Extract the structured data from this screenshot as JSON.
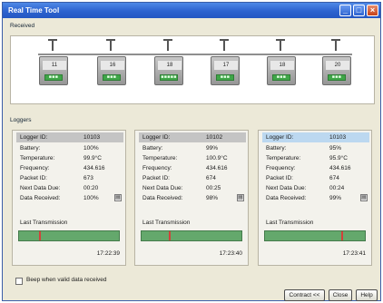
{
  "window": {
    "title": "Real Time Tool"
  },
  "received": {
    "label": "Received",
    "nodes": [
      {
        "id": "11",
        "led": "■■■"
      },
      {
        "id": "16",
        "led": "■■■"
      },
      {
        "id": "18",
        "led": "■■■■■"
      },
      {
        "id": "17",
        "led": "■■■"
      },
      {
        "id": "18",
        "led": "■■■"
      },
      {
        "id": "20",
        "led": "■■■"
      }
    ]
  },
  "loggers": {
    "label": "Loggers",
    "panels": [
      {
        "logger_id_label": "Logger ID:",
        "logger_id": "10103",
        "battery_label": "Battery:",
        "battery": "100%",
        "temperature_label": "Temperature:",
        "temperature": "99.9°C",
        "frequency_label": "Frequency:",
        "frequency": "434.616",
        "packet_id_label": "Packet ID:",
        "packet_id": "673",
        "next_data_due_label": "Next Data Due:",
        "next_data_due": "00:20",
        "data_received_label": "Data Received:",
        "data_received": "100%",
        "last_transmission_label": "Last Transmission",
        "last_transmission_time": "17:22:39",
        "transmission_fraction": 0.2
      },
      {
        "logger_id_label": "Logger ID:",
        "logger_id": "10102",
        "battery_label": "Battery:",
        "battery": "99%",
        "temperature_label": "Temperature:",
        "temperature": "100.9°C",
        "frequency_label": "Frequency:",
        "frequency": "434.616",
        "packet_id_label": "Packet ID:",
        "packet_id": "674",
        "next_data_due_label": "Next Data Due:",
        "next_data_due": "00:25",
        "data_received_label": "Data Received:",
        "data_received": "98%",
        "last_transmission_label": "Last Transmission",
        "last_transmission_time": "17:23:40",
        "transmission_fraction": 0.28
      },
      {
        "logger_id_label": "Logger ID:",
        "logger_id": "10103",
        "battery_label": "Battery:",
        "battery": "95%",
        "temperature_label": "Temperature:",
        "temperature": "95.9°C",
        "frequency_label": "Frequency:",
        "frequency": "434.616",
        "packet_id_label": "Packet ID:",
        "packet_id": "674",
        "next_data_due_label": "Next Data Due:",
        "next_data_due": "00:24",
        "data_received_label": "Data Received:",
        "data_received": "99%",
        "last_transmission_label": "Last Transmission",
        "last_transmission_time": "17:23:41",
        "transmission_fraction": 0.78
      }
    ]
  },
  "footer": {
    "beep_label": "Beep when valid data received",
    "contract_label": "Contract <<",
    "close_label": "Close",
    "help_label": "Help"
  }
}
